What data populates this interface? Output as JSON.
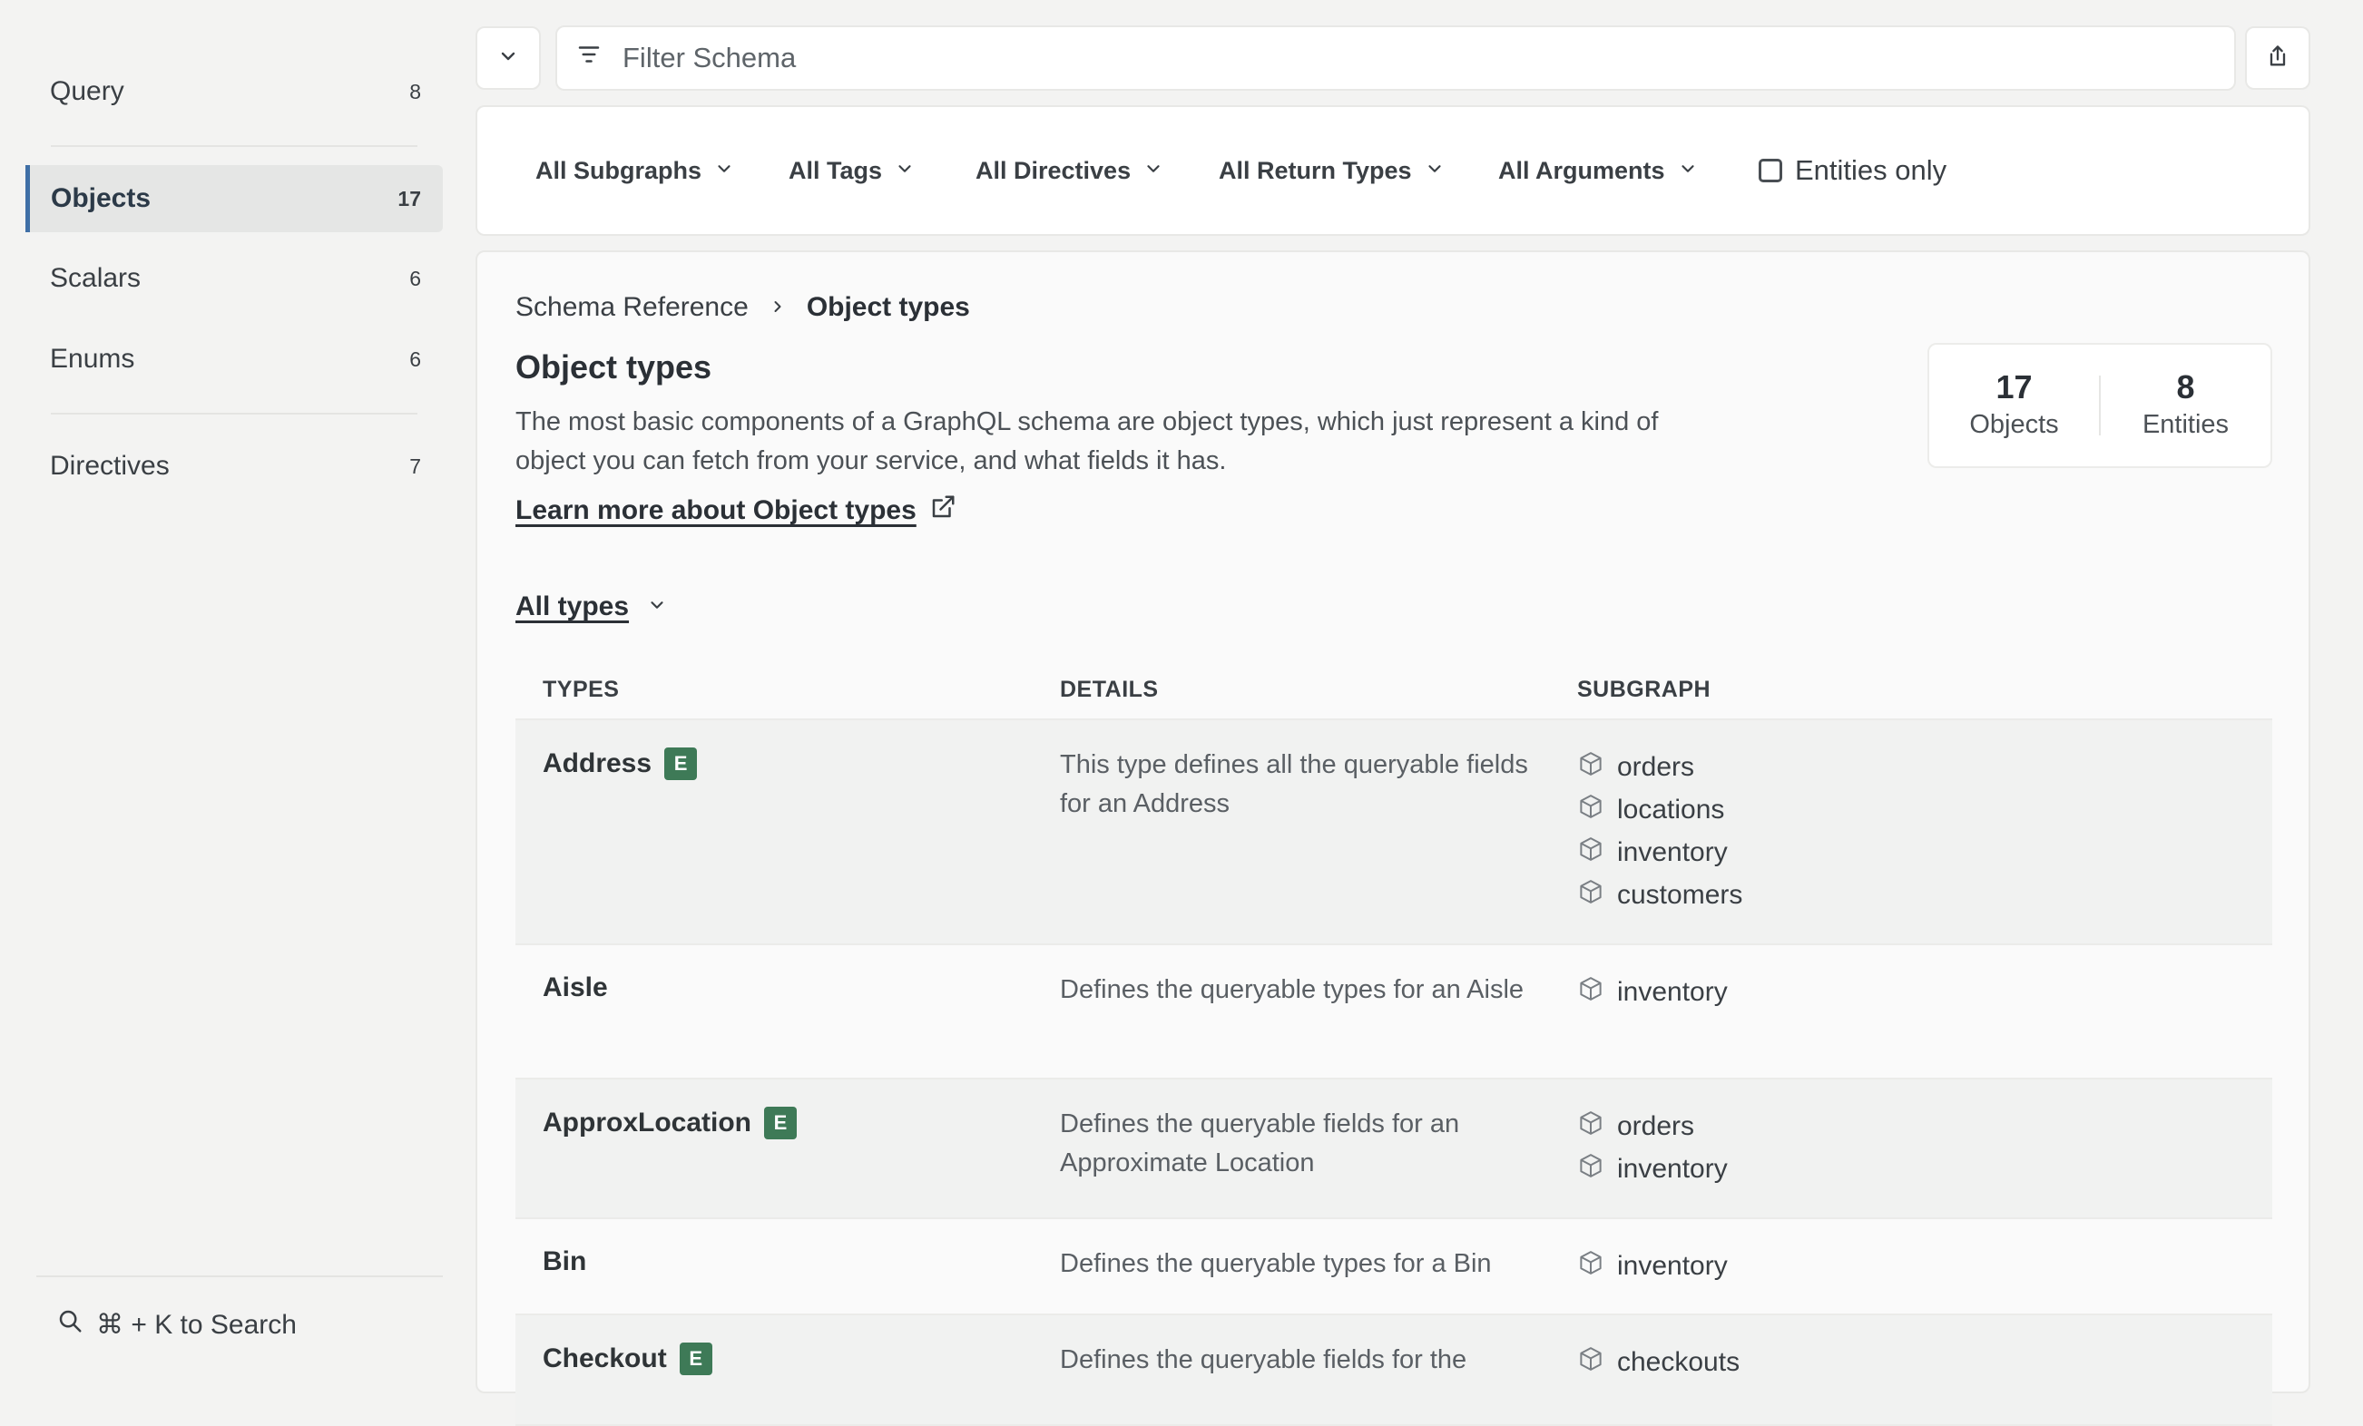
{
  "sidebar": {
    "items": [
      {
        "label": "Query",
        "count": "8"
      },
      {
        "label": "Objects",
        "count": "17"
      },
      {
        "label": "Scalars",
        "count": "6"
      },
      {
        "label": "Enums",
        "count": "6"
      },
      {
        "label": "Directives",
        "count": "7"
      }
    ],
    "active": "Objects",
    "search_hint": "⌘ + K to Search"
  },
  "toolbar": {
    "filter_placeholder": "Filter Schema"
  },
  "filters": {
    "dropdowns": [
      "All Subgraphs",
      "All Tags",
      "All Directives",
      "All Return Types",
      "All Arguments"
    ],
    "entities_only_label": "Entities only",
    "entities_only_checked": false
  },
  "breadcrumb": {
    "root": "Schema Reference",
    "current": "Object types"
  },
  "page": {
    "title": "Object types",
    "description": "The most basic components of a GraphQL schema are object types, which just represent a kind of object you can fetch from your service, and what fields it has.",
    "learn_more": "Learn more about Object types",
    "type_filter": "All types"
  },
  "stats": {
    "objects_count": "17",
    "objects_label": "Objects",
    "entities_count": "8",
    "entities_label": "Entities"
  },
  "table": {
    "headers": {
      "types": "TYPES",
      "details": "DETAILS",
      "subgraph": "SUBGRAPH"
    },
    "entity_badge": "E",
    "rows": [
      {
        "name": "Address",
        "entity": true,
        "details": "This type defines all the queryable fields for an Address",
        "subgraphs": [
          "orders",
          "locations",
          "inventory",
          "customers"
        ]
      },
      {
        "name": "Aisle",
        "entity": false,
        "details": "Defines the queryable types for an Aisle",
        "subgraphs": [
          "inventory"
        ]
      },
      {
        "name": "ApproxLocation",
        "entity": true,
        "details": "Defines the queryable fields for an Approximate Location",
        "subgraphs": [
          "orders",
          "inventory"
        ]
      },
      {
        "name": "Bin",
        "entity": false,
        "details": "Defines the queryable types for a Bin",
        "subgraphs": [
          "inventory"
        ]
      },
      {
        "name": "Checkout",
        "entity": true,
        "details": "Defines the queryable fields for the",
        "subgraphs": [
          "checkouts"
        ]
      }
    ]
  },
  "colors": {
    "accent": "#3f6fa6",
    "entity_badge": "#3e7a57",
    "background": "#f3f3f2"
  },
  "icons": [
    "chevron-down-icon",
    "filter-icon",
    "share-icon",
    "external-link-icon",
    "cube-icon",
    "search-icon",
    "chevron-right-icon"
  ]
}
